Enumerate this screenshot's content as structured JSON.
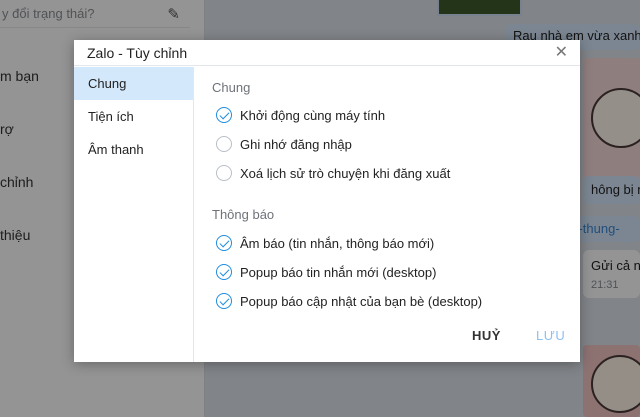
{
  "background": {
    "status_placeholder": "y đổi trạng thái?",
    "left_menu": [
      "m bạn",
      "rợ",
      "chỉnh",
      "thiệu"
    ],
    "chat": {
      "message_1": "Rau nhà em vừa xanh v",
      "message_2": "hông bị nh",
      "message_3": "ng-thung-",
      "message_4": "Gửi cả nh",
      "message_4_time": "21:31"
    }
  },
  "dialog": {
    "title": "Zalo - Tùy chỉnh",
    "close_icon": "close-icon",
    "sidebar": {
      "items": [
        {
          "label": "Chung",
          "active": true
        },
        {
          "label": "Tiện ích",
          "active": false
        },
        {
          "label": "Âm thanh",
          "active": false
        }
      ]
    },
    "general": {
      "section_title": "Chung",
      "options": [
        {
          "label": "Khởi động cùng máy tính",
          "checked": true
        },
        {
          "label": "Ghi nhớ đăng nhập",
          "checked": false
        },
        {
          "label": "Xoá lịch sử trò chuyện khi đăng xuất",
          "checked": false
        }
      ]
    },
    "notifications": {
      "section_title": "Thông báo",
      "options": [
        {
          "label": "Âm báo (tin nhắn, thông báo mới)",
          "checked": true
        },
        {
          "label": "Popup báo tin nhắn mới (desktop)",
          "checked": true
        },
        {
          "label": "Popup báo cập nhật của bạn bè (desktop)",
          "checked": true
        }
      ]
    },
    "footer": {
      "cancel_label": "HUỶ",
      "save_label": "LƯU"
    }
  },
  "colors": {
    "accent": "#1f8ce0",
    "active_tab_bg": "#d4e8fb",
    "save_disabled": "#8cc0f2"
  }
}
